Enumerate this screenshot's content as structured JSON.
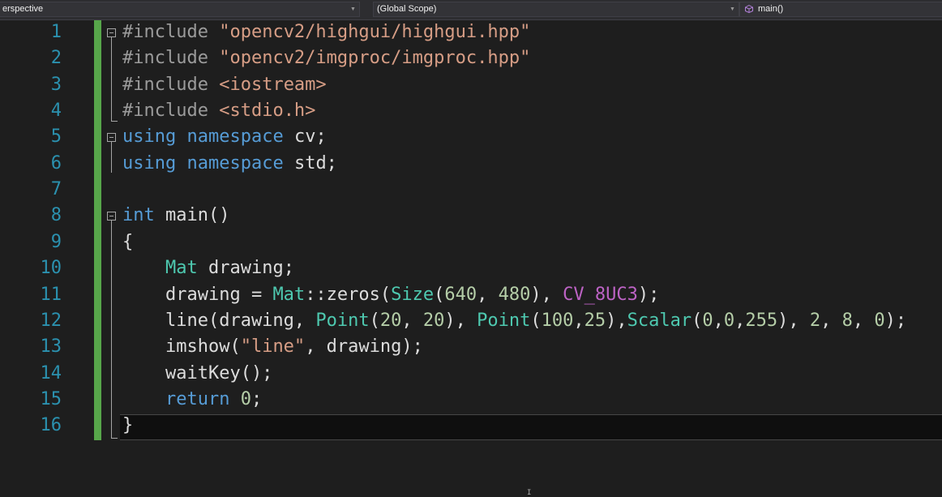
{
  "navbar": {
    "project_combo": "erspective",
    "scope_combo": "(Global Scope)",
    "member_combo": "main()"
  },
  "gutter": {
    "line_numbers": [
      "1",
      "2",
      "3",
      "4",
      "5",
      "6",
      "7",
      "8",
      "9",
      "10",
      "11",
      "12",
      "13",
      "14",
      "15",
      "16"
    ]
  },
  "code": {
    "lines": [
      [
        {
          "c": "pp",
          "t": "#include "
        },
        {
          "c": "str",
          "t": "\"opencv2/highgui/highgui.hpp\""
        }
      ],
      [
        {
          "c": "pp",
          "t": "#include "
        },
        {
          "c": "str",
          "t": "\"opencv2/imgproc/imgproc.hpp\""
        }
      ],
      [
        {
          "c": "pp",
          "t": "#include "
        },
        {
          "c": "str",
          "t": "<iostream>"
        }
      ],
      [
        {
          "c": "pp",
          "t": "#include "
        },
        {
          "c": "str",
          "t": "<stdio.h>"
        }
      ],
      [
        {
          "c": "kw",
          "t": "using"
        },
        {
          "c": "pl",
          "t": " "
        },
        {
          "c": "kw",
          "t": "namespace"
        },
        {
          "c": "pl",
          "t": " cv;"
        }
      ],
      [
        {
          "c": "kw",
          "t": "using"
        },
        {
          "c": "pl",
          "t": " "
        },
        {
          "c": "kw",
          "t": "namespace"
        },
        {
          "c": "pl",
          "t": " std;"
        }
      ],
      [],
      [
        {
          "c": "kw",
          "t": "int"
        },
        {
          "c": "pl",
          "t": " main()"
        }
      ],
      [
        {
          "c": "pl",
          "t": "{"
        }
      ],
      [
        {
          "c": "pl",
          "t": "    "
        },
        {
          "c": "ty",
          "t": "Mat"
        },
        {
          "c": "pl",
          "t": " drawing;"
        }
      ],
      [
        {
          "c": "pl",
          "t": "    drawing = "
        },
        {
          "c": "ty",
          "t": "Mat"
        },
        {
          "c": "pl",
          "t": "::zeros("
        },
        {
          "c": "ty",
          "t": "Size"
        },
        {
          "c": "pl",
          "t": "("
        },
        {
          "c": "num",
          "t": "640"
        },
        {
          "c": "pl",
          "t": ", "
        },
        {
          "c": "num",
          "t": "480"
        },
        {
          "c": "pl",
          "t": "), "
        },
        {
          "c": "mac",
          "t": "CV_8UC3"
        },
        {
          "c": "pl",
          "t": ");"
        }
      ],
      [
        {
          "c": "pl",
          "t": "    line(drawing, "
        },
        {
          "c": "ty",
          "t": "Point"
        },
        {
          "c": "pl",
          "t": "("
        },
        {
          "c": "num",
          "t": "20"
        },
        {
          "c": "pl",
          "t": ", "
        },
        {
          "c": "num",
          "t": "20"
        },
        {
          "c": "pl",
          "t": "), "
        },
        {
          "c": "ty",
          "t": "Point"
        },
        {
          "c": "pl",
          "t": "("
        },
        {
          "c": "num",
          "t": "100"
        },
        {
          "c": "pl",
          "t": ","
        },
        {
          "c": "num",
          "t": "25"
        },
        {
          "c": "pl",
          "t": "),"
        },
        {
          "c": "ty",
          "t": "Scalar"
        },
        {
          "c": "pl",
          "t": "("
        },
        {
          "c": "num",
          "t": "0"
        },
        {
          "c": "pl",
          "t": ","
        },
        {
          "c": "num",
          "t": "0"
        },
        {
          "c": "pl",
          "t": ","
        },
        {
          "c": "num",
          "t": "255"
        },
        {
          "c": "pl",
          "t": "), "
        },
        {
          "c": "num",
          "t": "2"
        },
        {
          "c": "pl",
          "t": ", "
        },
        {
          "c": "num",
          "t": "8"
        },
        {
          "c": "pl",
          "t": ", "
        },
        {
          "c": "num",
          "t": "0"
        },
        {
          "c": "pl",
          "t": ");"
        }
      ],
      [
        {
          "c": "pl",
          "t": "    imshow("
        },
        {
          "c": "str",
          "t": "\"line\""
        },
        {
          "c": "pl",
          "t": ", drawing);"
        }
      ],
      [
        {
          "c": "pl",
          "t": "    waitKey();"
        }
      ],
      [
        {
          "c": "pl",
          "t": "    "
        },
        {
          "c": "kw",
          "t": "return"
        },
        {
          "c": "pl",
          "t": " "
        },
        {
          "c": "num",
          "t": "0"
        },
        {
          "c": "pl",
          "t": ";"
        }
      ],
      [
        {
          "c": "pl",
          "t": "}"
        }
      ]
    ]
  },
  "colors": {
    "background": "#1e1e1e",
    "line_number": "#2b91af",
    "keyword": "#569cd6",
    "preprocessor": "#9b9b9b",
    "string": "#d69d85",
    "type": "#4ec9b0",
    "number": "#b5cea8",
    "macro": "#bd63c5",
    "change_marker": "#57a64a"
  },
  "icons": {
    "member_icon": "method-cube-icon",
    "fold_icon": "collapse-minus-icon"
  }
}
